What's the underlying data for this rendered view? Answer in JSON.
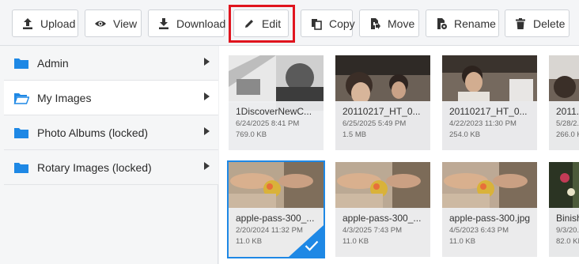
{
  "toolbar": {
    "buttons": [
      {
        "label": "Upload",
        "icon": "upload-icon"
      },
      {
        "label": "View",
        "icon": "eye-icon"
      },
      {
        "label": "Download",
        "icon": "download-icon"
      },
      {
        "label": "Edit",
        "icon": "pencil-icon"
      },
      {
        "label": "Copy",
        "icon": "copy-icon"
      },
      {
        "label": "Move",
        "icon": "move-icon"
      },
      {
        "label": "Rename",
        "icon": "rename-icon"
      },
      {
        "label": "Delete",
        "icon": "trash-icon"
      }
    ],
    "highlight_color": "#e0141e"
  },
  "sidebar": {
    "items": [
      {
        "label": "Admin"
      },
      {
        "label": "My Images"
      },
      {
        "label": "Photo Albums (locked)"
      },
      {
        "label": "Rotary Images (locked)"
      }
    ],
    "selected": "My Images",
    "folder_color": "#1e88e5"
  },
  "files": [
    {
      "name": "1DiscoverNewC...",
      "date": "6/24/2025 8:41 PM",
      "size": "769.0 KB"
    },
    {
      "name": "20110217_HT_0...",
      "date": "6/25/2025 5:49 PM",
      "size": "1.5 MB"
    },
    {
      "name": "20110217_HT_0...",
      "date": "4/22/2023 11:30 PM",
      "size": "254.0 KB"
    },
    {
      "name": "2011...",
      "date": "5/28/2...",
      "size": "266.0 KB"
    },
    {
      "name": "apple-pass-300_...",
      "date": "2/20/2024 11:32 PM",
      "size": "11.0 KB"
    },
    {
      "name": "apple-pass-300_...",
      "date": "4/3/2025 7:43 PM",
      "size": "11.0 KB"
    },
    {
      "name": "apple-pass-300.jpg",
      "date": "4/5/2023 6:43 PM",
      "size": "11.0 KB"
    },
    {
      "name": "Binish...",
      "date": "9/3/20...",
      "size": "82.0 KB"
    }
  ],
  "accent_color": "#1e88e5"
}
